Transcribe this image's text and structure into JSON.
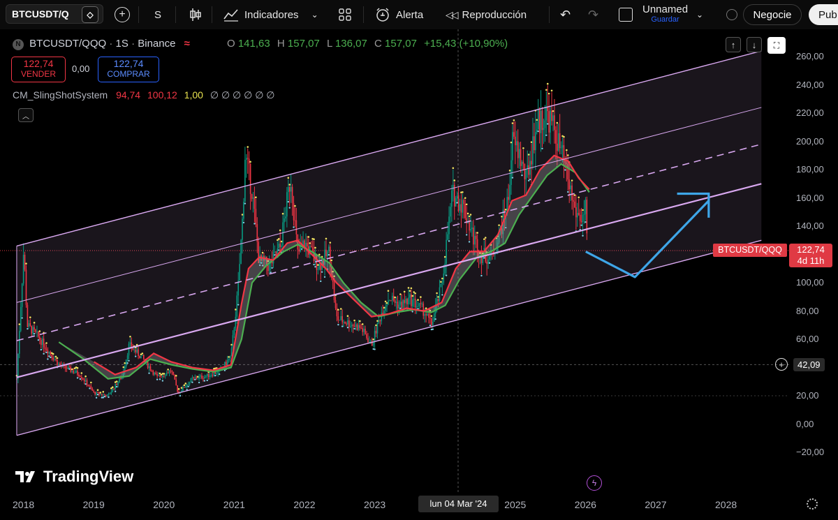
{
  "toolbar": {
    "symbol": "BTCUSDT/Q",
    "interval": "S",
    "indicators_label": "Indicadores",
    "alert_label": "Alerta",
    "replay_label": "Reproducción",
    "layout_name": "Unnamed",
    "layout_sub": "Guardar",
    "trade_button": "Negocie",
    "publish_button": "Pub"
  },
  "legend": {
    "symbol": "BTCUSDT/QQQ",
    "interval": "1S",
    "exchange": "Binance",
    "o_label": "O",
    "o_value": "141,63",
    "h_label": "H",
    "h_value": "157,07",
    "l_label": "L",
    "l_value": "136,07",
    "c_label": "C",
    "c_value": "157,07",
    "change": "+15,43 (+10,90%)",
    "sell_price": "122,74",
    "sell_label": "VENDER",
    "spread": "0,00",
    "buy_price": "122,74",
    "buy_label": "COMPRAR",
    "indicator_name": "CM_SlingShotSystem",
    "ind_v1": "94,74",
    "ind_v2": "100,12",
    "ind_v3": "1,00",
    "ind_na": "∅ ∅ ∅ ∅ ∅ ∅"
  },
  "price_axis": {
    "ticks": [
      "260,00",
      "240,00",
      "220,00",
      "200,00",
      "180,00",
      "160,00",
      "140,00",
      "100,00",
      "80,00",
      "60,00",
      "20,00",
      "0,00",
      "−20,00"
    ],
    "tick_values": [
      260,
      240,
      220,
      200,
      180,
      160,
      140,
      100,
      80,
      60,
      20,
      0,
      -20
    ],
    "last_price": "122,74",
    "last_price_value": 122.74,
    "countdown": "4d 11h",
    "last_symbol_tag": "BTCUSDT/QQQ",
    "crosshair_price": "42,09",
    "crosshair_value": 42.09
  },
  "time_axis": {
    "labels": [
      "2018",
      "2019",
      "2020",
      "2021",
      "2022",
      "2023",
      "2025",
      "2026",
      "2027",
      "2028"
    ],
    "years": [
      2018,
      2019,
      2020,
      2021,
      2022,
      2023,
      2025,
      2026,
      2027,
      2028
    ],
    "crosshair_date": "lun 04 Mar '24"
  },
  "brand": {
    "name": "TradingView"
  },
  "colors": {
    "up": "#089981",
    "down": "#f23645",
    "channel": "#d9a8f0",
    "ma_fast": "#f23645",
    "ma_slow": "#4caf50",
    "projection": "#3ea6e8",
    "accent_sell": "#f23645",
    "accent_buy": "#2962ff"
  },
  "chart_data": {
    "type": "candlestick",
    "projection_path": [
      [
        2026.0,
        122
      ],
      [
        2026.7,
        104
      ],
      [
        2027.75,
        158
      ]
    ],
    "projection_hook": [
      [
        2027.3,
        163
      ],
      [
        2027.75,
        163
      ],
      [
        2027.75,
        146
      ]
    ],
    "channel": {
      "x0": 2017.9,
      "x1": 2028.5,
      "lower": [
        -8,
        130
      ],
      "lower_mid": [
        33,
        170
      ],
      "center": [
        59,
        198
      ],
      "upper_mid": [
        86,
        224
      ],
      "upper": [
        126,
        264
      ]
    },
    "price_path": [
      [
        2017.9,
        32
      ],
      [
        2018.0,
        124
      ],
      [
        2018.05,
        70
      ],
      [
        2018.2,
        62
      ],
      [
        2018.5,
        42
      ],
      [
        2018.8,
        35
      ],
      [
        2019.0,
        22
      ],
      [
        2019.2,
        20
      ],
      [
        2019.4,
        34
      ],
      [
        2019.5,
        56
      ],
      [
        2019.7,
        46
      ],
      [
        2019.9,
        33
      ],
      [
        2020.1,
        38
      ],
      [
        2020.2,
        22
      ],
      [
        2020.4,
        32
      ],
      [
        2020.6,
        34
      ],
      [
        2020.8,
        38
      ],
      [
        2020.95,
        48
      ],
      [
        2021.05,
        95
      ],
      [
        2021.12,
        150
      ],
      [
        2021.15,
        190
      ],
      [
        2021.25,
        165
      ],
      [
        2021.35,
        115
      ],
      [
        2021.5,
        112
      ],
      [
        2021.65,
        125
      ],
      [
        2021.8,
        175
      ],
      [
        2021.9,
        120
      ],
      [
        2022.0,
        128
      ],
      [
        2022.2,
        112
      ],
      [
        2022.35,
        122
      ],
      [
        2022.45,
        75
      ],
      [
        2022.6,
        72
      ],
      [
        2022.8,
        68
      ],
      [
        2022.95,
        56
      ],
      [
        2023.1,
        80
      ],
      [
        2023.2,
        90
      ],
      [
        2023.35,
        84
      ],
      [
        2023.5,
        88
      ],
      [
        2023.7,
        80
      ],
      [
        2023.8,
        70
      ],
      [
        2023.95,
        98
      ],
      [
        2024.0,
        120
      ],
      [
        2024.1,
        163
      ],
      [
        2024.25,
        155
      ],
      [
        2024.4,
        132
      ],
      [
        2024.5,
        120
      ],
      [
        2024.65,
        118
      ],
      [
        2024.75,
        130
      ],
      [
        2024.9,
        160
      ],
      [
        2024.95,
        200
      ],
      [
        2025.05,
        192
      ],
      [
        2025.15,
        172
      ],
      [
        2025.3,
        212
      ],
      [
        2025.45,
        220
      ],
      [
        2025.55,
        208
      ],
      [
        2025.65,
        192
      ],
      [
        2025.75,
        172
      ],
      [
        2025.85,
        150
      ],
      [
        2025.95,
        145
      ],
      [
        2026.0,
        152
      ],
      [
        2026.02,
        122
      ]
    ],
    "ma_fast_path": [
      [
        2019.0,
        44
      ],
      [
        2019.3,
        35
      ],
      [
        2019.6,
        40
      ],
      [
        2019.85,
        50
      ],
      [
        2020.1,
        44
      ],
      [
        2020.4,
        40
      ],
      [
        2020.7,
        38
      ],
      [
        2020.95,
        42
      ],
      [
        2021.1,
        85
      ],
      [
        2021.2,
        110
      ],
      [
        2021.35,
        118
      ],
      [
        2021.55,
        116
      ],
      [
        2021.75,
        128
      ],
      [
        2021.9,
        130
      ],
      [
        2022.1,
        120
      ],
      [
        2022.3,
        110
      ],
      [
        2022.45,
        100
      ],
      [
        2022.7,
        88
      ],
      [
        2022.95,
        76
      ],
      [
        2023.2,
        78
      ],
      [
        2023.45,
        82
      ],
      [
        2023.7,
        80
      ],
      [
        2023.95,
        86
      ],
      [
        2024.15,
        110
      ],
      [
        2024.35,
        122
      ],
      [
        2024.55,
        122
      ],
      [
        2024.75,
        134
      ],
      [
        2024.95,
        158
      ],
      [
        2025.15,
        162
      ],
      [
        2025.35,
        180
      ],
      [
        2025.55,
        190
      ],
      [
        2025.75,
        186
      ],
      [
        2025.9,
        174
      ],
      [
        2026.05,
        166
      ]
    ],
    "ma_slow_path": [
      [
        2018.5,
        58
      ],
      [
        2018.85,
        46
      ],
      [
        2019.2,
        32
      ],
      [
        2019.5,
        34
      ],
      [
        2019.8,
        46
      ],
      [
        2020.1,
        42
      ],
      [
        2020.4,
        39
      ],
      [
        2020.7,
        37
      ],
      [
        2020.95,
        40
      ],
      [
        2021.1,
        60
      ],
      [
        2021.25,
        100
      ],
      [
        2021.45,
        112
      ],
      [
        2021.7,
        122
      ],
      [
        2021.9,
        127
      ],
      [
        2022.1,
        122
      ],
      [
        2022.35,
        114
      ],
      [
        2022.55,
        100
      ],
      [
        2022.8,
        86
      ],
      [
        2023.05,
        76
      ],
      [
        2023.3,
        79
      ],
      [
        2023.55,
        81
      ],
      [
        2023.8,
        79
      ],
      [
        2024.0,
        84
      ],
      [
        2024.2,
        102
      ],
      [
        2024.45,
        118
      ],
      [
        2024.65,
        122
      ],
      [
        2024.85,
        128
      ],
      [
        2025.05,
        148
      ],
      [
        2025.25,
        162
      ],
      [
        2025.45,
        176
      ],
      [
        2025.65,
        184
      ],
      [
        2025.85,
        178
      ],
      [
        2026.05,
        164
      ]
    ],
    "xlim": [
      2017.85,
      2028.5
    ],
    "ylim": [
      -28,
      266
    ]
  }
}
